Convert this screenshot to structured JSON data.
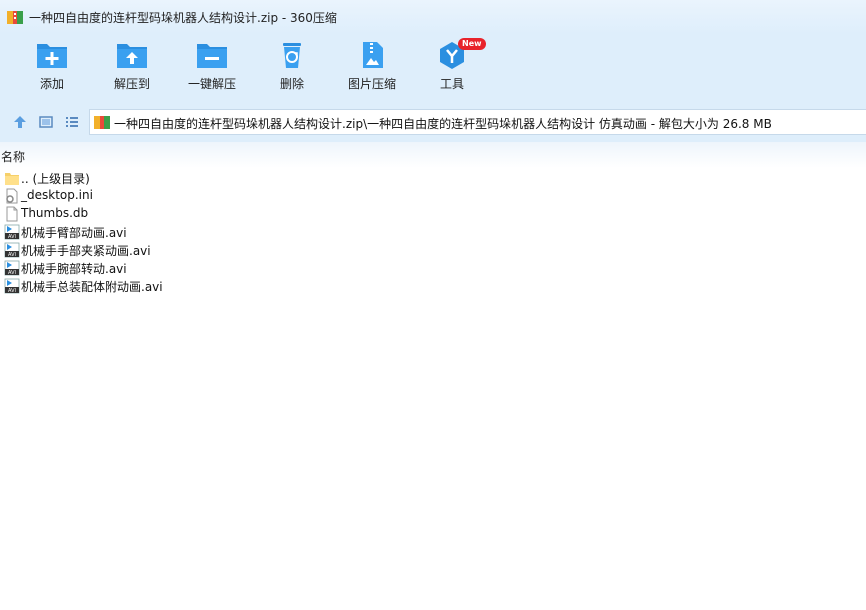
{
  "window": {
    "title": "一种四自由度的连杆型码垛机器人结构设计.zip - 360压缩"
  },
  "toolbar": {
    "add_label": "添加",
    "extract_to_label": "解压到",
    "one_click_extract_label": "一键解压",
    "delete_label": "删除",
    "image_compress_label": "图片压缩",
    "tools_label": "工具",
    "tools_badge": "New"
  },
  "address": {
    "path": "一种四自由度的连杆型码垛机器人结构设计.zip\\一种四自由度的连杆型码垛机器人结构设计 仿真动画 - 解包大小为 26.8 MB"
  },
  "list": {
    "column_name": "名称",
    "items": [
      {
        "name": ".. (上级目录)",
        "icon": "folder-icon"
      },
      {
        "name": "_desktop.ini",
        "icon": "ini-file-icon"
      },
      {
        "name": "Thumbs.db",
        "icon": "db-file-icon"
      },
      {
        "name": "机械手臂部动画.avi",
        "icon": "avi-file-icon"
      },
      {
        "name": "机械手手部夹紧动画.avi",
        "icon": "avi-file-icon"
      },
      {
        "name": "机械手腕部转动.avi",
        "icon": "avi-file-icon"
      },
      {
        "name": "机械手总装配体附动画.avi",
        "icon": "avi-file-icon"
      }
    ]
  },
  "colors": {
    "accent": "#2b8fe0",
    "toolbar_bg": "#deeefb",
    "badge": "#e8232b"
  }
}
